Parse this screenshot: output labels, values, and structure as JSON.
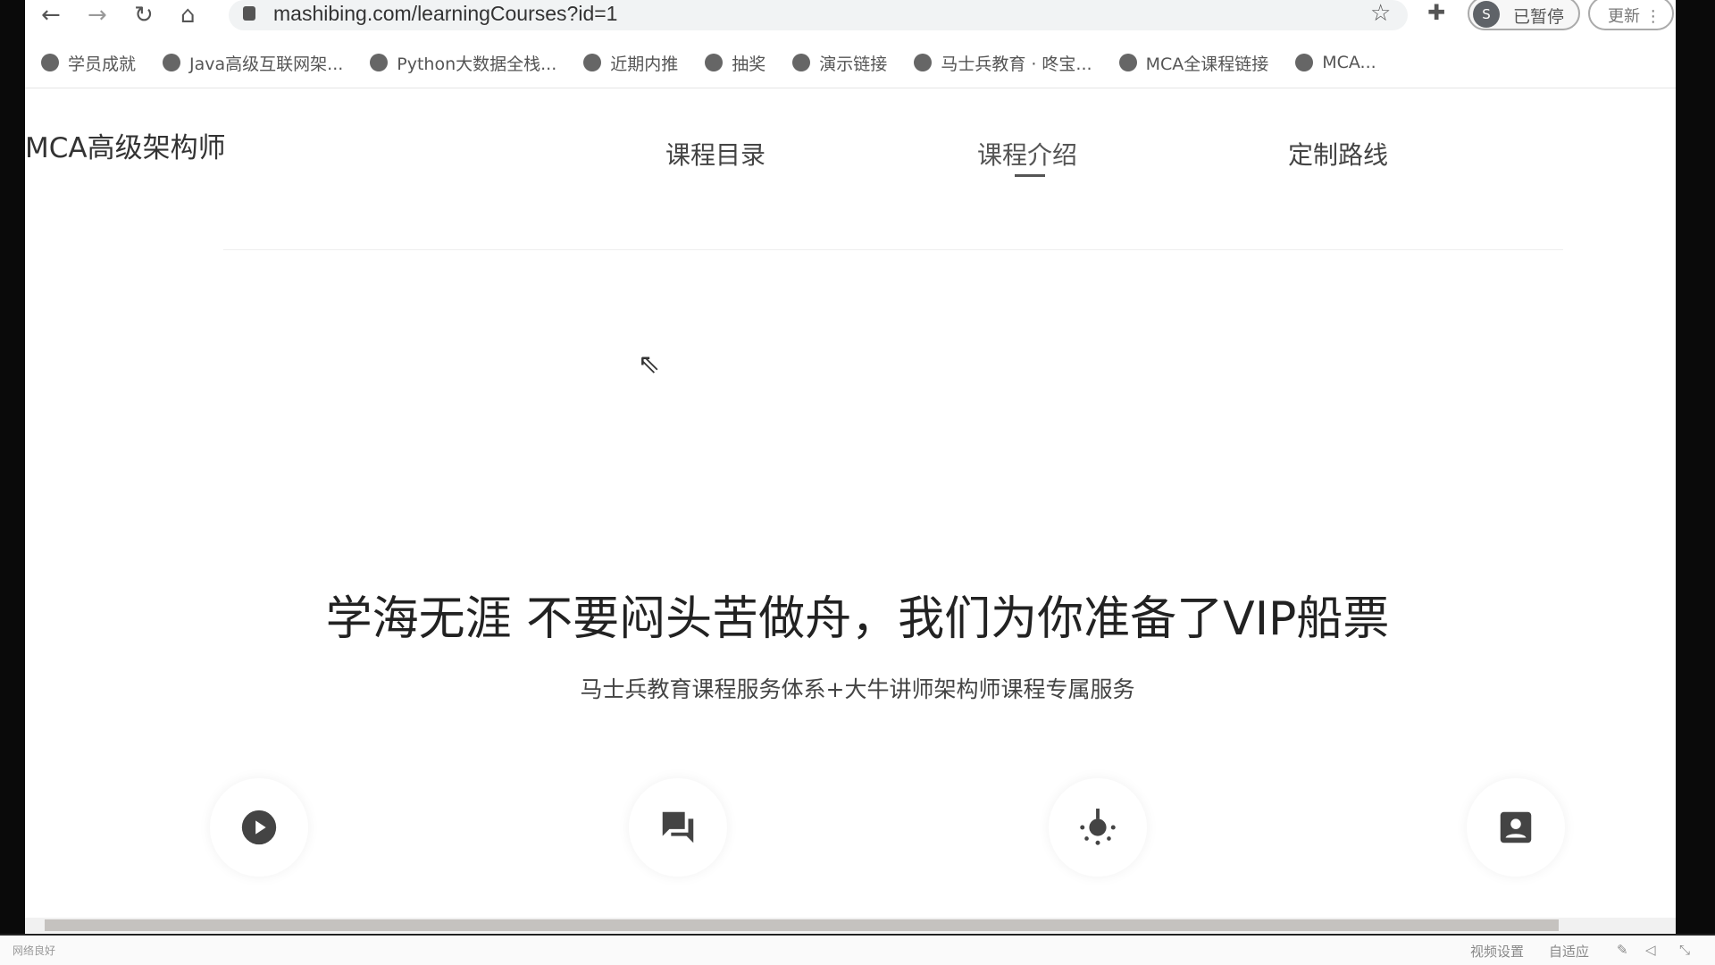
{
  "browser": {
    "url": "mashibing.com/learningCourses?id=1",
    "profile_initial": "S",
    "profile_status": "已暂停",
    "update_label": "更新",
    "bookmarks": [
      "学员成就",
      "Java高级互联网架...",
      "Python大数据全栈...",
      "近期内推",
      "抽奖",
      "演示链接",
      "马士兵教育 · 咚宝...",
      "MCA全课程链接",
      "MCA..."
    ]
  },
  "page": {
    "logo": "MCA高级架构师",
    "tabs": [
      {
        "label": "课程目录"
      },
      {
        "label": "课程介绍",
        "active": true
      },
      {
        "label": "定制路线"
      }
    ],
    "headline": "学海无涯 不要闷头苦做舟，我们为你准备了VIP船票",
    "subtitle": "马士兵教育课程服务体系+大牛讲师架构师课程专属服务",
    "features": [
      "play-icon",
      "chat-icon",
      "bulb-icon",
      "contact-icon"
    ]
  },
  "player_status": {
    "network": "网络良好",
    "video_settings": "视频设置",
    "adaptive": "自适应"
  }
}
